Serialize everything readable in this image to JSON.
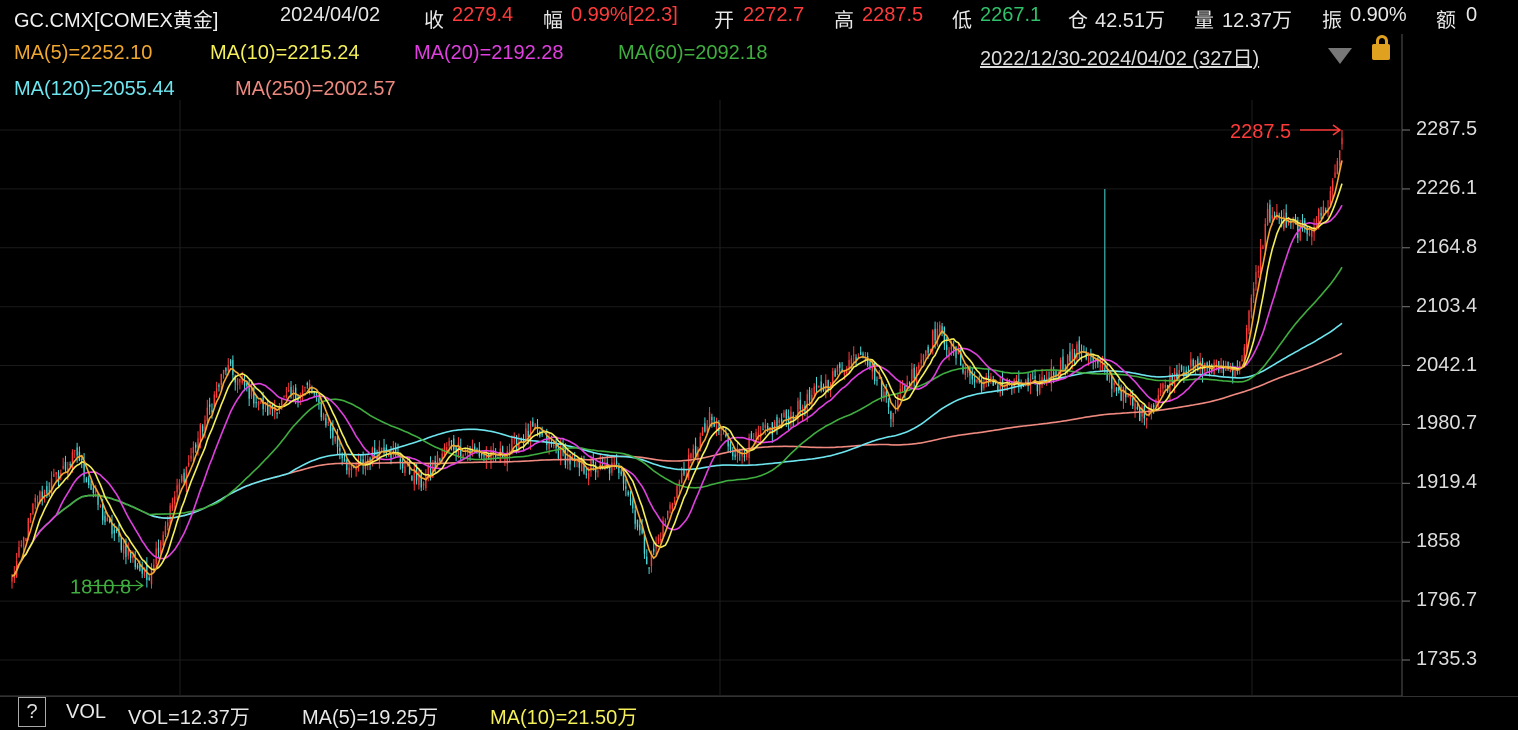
{
  "header": {
    "symbol": "GC.CMX[COMEX黄金]",
    "date": "2024/04/02",
    "close_label": "收",
    "close": "2279.4",
    "change_label": "幅",
    "change": "0.99%[22.3]",
    "open_label": "开",
    "open": "2272.7",
    "high_label": "高",
    "high": "2287.5",
    "low_label": "低",
    "low": "2267.1",
    "oi_label": "仓",
    "oi": "42.51万",
    "vol_label": "量",
    "vol": "12.37万",
    "amp_label": "振",
    "amp": "0.90%",
    "amount_label": "额",
    "amount": "0"
  },
  "ma_legend": [
    {
      "text": "MA(5)=2252.10",
      "color": "#f0a830"
    },
    {
      "text": "MA(10)=2215.24",
      "color": "#f5f05a"
    },
    {
      "text": "MA(20)=2192.28",
      "color": "#e040e0"
    },
    {
      "text": "MA(60)=2092.18",
      "color": "#3fae3f"
    },
    {
      "text": "MA(120)=2055.44",
      "color": "#6ee6f0"
    },
    {
      "text": "MA(250)=2002.57",
      "color": "#f08a80"
    }
  ],
  "range_label": "2022/12/30-2024/04/02 (327日)",
  "bottom": {
    "help": "?",
    "vol_title": "VOL",
    "vol_value": "VOL=12.37万",
    "vol_ma5": "MA(5)=19.25万",
    "vol_ma10": "MA(10)=21.50万"
  },
  "chart_data": {
    "type": "candlestick",
    "ylim": [
      1735.3,
      2287.5
    ],
    "y_ticks": [
      "2287.5",
      "2226.1",
      "2164.8",
      "2103.4",
      "2042.1",
      "1980.7",
      "1919.4",
      "1858",
      "1796.7",
      "1735.3"
    ],
    "high_marker": "2287.5",
    "low_marker": "1810.8",
    "colors": {
      "up": "#ff3b3b",
      "down": "#4ad8d8"
    },
    "close_anchors": [
      [
        0,
        1820
      ],
      [
        10,
        1900
      ],
      [
        28,
        1950
      ],
      [
        40,
        1880
      ],
      [
        58,
        1820
      ],
      [
        70,
        1905
      ],
      [
        92,
        2040
      ],
      [
        110,
        1995
      ],
      [
        128,
        2020
      ],
      [
        146,
        1930
      ],
      [
        160,
        1960
      ],
      [
        176,
        1920
      ],
      [
        188,
        1960
      ],
      [
        208,
        1945
      ],
      [
        224,
        1975
      ],
      [
        244,
        1935
      ],
      [
        262,
        1935
      ],
      [
        274,
        1835
      ],
      [
        286,
        1915
      ],
      [
        300,
        1985
      ],
      [
        312,
        1950
      ],
      [
        340,
        2000
      ],
      [
        366,
        2060
      ],
      [
        378,
        1995
      ],
      [
        398,
        2080
      ],
      [
        414,
        2025
      ],
      [
        440,
        2020
      ],
      [
        460,
        2060
      ],
      [
        486,
        1990
      ],
      [
        502,
        2040
      ],
      [
        528,
        2040
      ],
      [
        540,
        2200
      ],
      [
        556,
        2180
      ],
      [
        566,
        2210
      ],
      [
        572,
        2279.4
      ]
    ],
    "ma_final": {
      "MA5": 2252.1,
      "MA10": 2215.24,
      "MA20": 2192.28,
      "MA60": 2092.18,
      "MA120": 2055.44,
      "MA250": 2002.57
    }
  }
}
